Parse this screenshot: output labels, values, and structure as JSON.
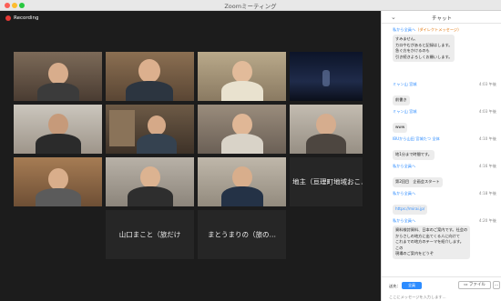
{
  "window": {
    "title": "Zoomミーティング"
  },
  "recording": {
    "label": "Recording"
  },
  "participants": [
    {
      "name": "地主（亘理町地域おこ…"
    },
    {
      "name": "山口まこと（旅だけ"
    },
    {
      "name": "まとうまりの（旅の…"
    }
  ],
  "chat": {
    "title": "チャット",
    "messages": [
      {
        "sender": "私から全員へ",
        "to": "（ダイレクトメッセージ）",
        "time": "",
        "text": "すみません、\nカロやむがあると記録はします。\n急ぐ方をかけるのも\n引き続きよろしくお願いします。"
      },
      {
        "sender": "ミャン山 宮城",
        "to": "",
        "time": "4:03 午後",
        "text": "前書き"
      },
      {
        "sender": "ミャン山 宮城",
        "to": "",
        "time": "4:03 午後",
        "text": "www"
      },
      {
        "sender": "IBUから山田 宮城たつ 全体",
        "to": "",
        "time": "4:10 午後",
        "text": "地1分まで時間です。"
      },
      {
        "sender": "私から全員へ",
        "to": "",
        "time": "4:16 午後",
        "text": "第2回目　企画会スタート"
      },
      {
        "sender": "私から全員へ",
        "to": "",
        "time": "4:18 午後",
        "text": "https://mirai.jp/"
      },
      {
        "sender": "私から全員へ",
        "to": "",
        "time": "4:20 午後",
        "text": "資料検討資料、日本のご案内です。社会の\nからさしの地方に出てくる人に向けて\nこれまでの地方のテーマを紹介します。\nこの\n現場のご案内をどうぞ"
      }
    ],
    "footer": {
      "to_label": "送先：",
      "to_value": "全員",
      "file_label": "ファイル",
      "more_label": "…",
      "input_placeholder": "ここにメッセージを入力します..."
    }
  },
  "colors": {
    "video_bg": "#1c1c1c",
    "link_blue": "#2d8cff",
    "recording_red": "#e53935",
    "active_speaker": "#a7e05a"
  }
}
